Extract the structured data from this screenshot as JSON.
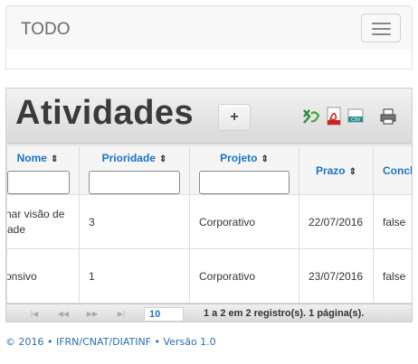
{
  "navbar": {
    "brand": "TODO"
  },
  "panel": {
    "title": "Atividades",
    "add_label": "+",
    "export_icons": [
      "excel-icon",
      "pdf-icon",
      "csv-icon",
      "printer-icon"
    ]
  },
  "table": {
    "columns": [
      {
        "label": "Nome",
        "sort": "⇕"
      },
      {
        "label": "Prioridade",
        "sort": "⇕"
      },
      {
        "label": "Projeto",
        "sort": "⇕"
      },
      {
        "label": "Prazo",
        "sort": "⇕"
      },
      {
        "label": "Conclu"
      }
    ],
    "rows": [
      {
        "nome": "nar visão de\nade",
        "prioridade": "3",
        "projeto": "Corporativo",
        "prazo": "22/07/2016",
        "concluido": "false"
      },
      {
        "nome": "onsivo",
        "prioridade": "1",
        "projeto": "Corporativo",
        "prazo": "23/07/2016",
        "concluido": "false"
      }
    ]
  },
  "pager": {
    "rows_per_page": "10",
    "info": "1 a 2 em 2 registro(s). 1 página(s)."
  },
  "footer": {
    "text": "©  2016  •  IFRN/CNAT/DIATINF  •  Versão 1.0"
  }
}
